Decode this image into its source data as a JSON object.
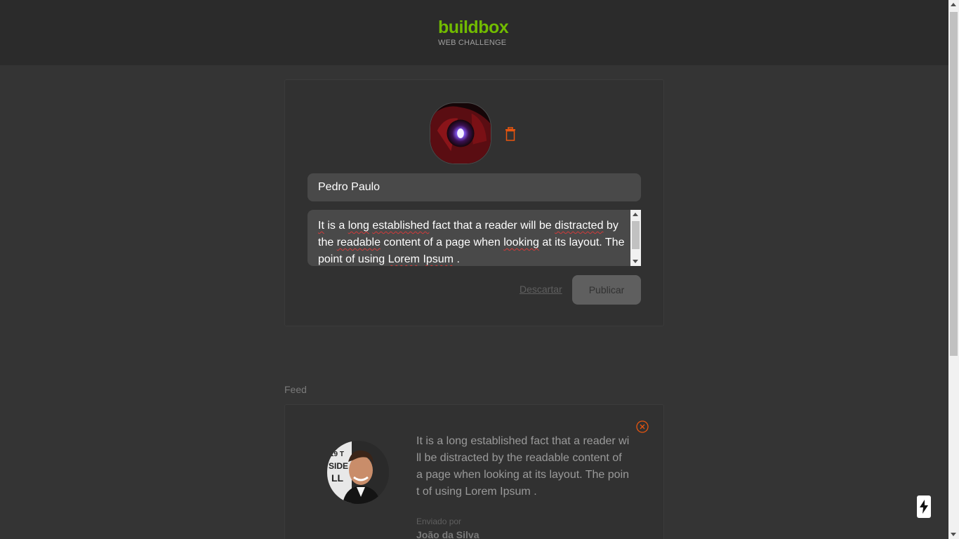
{
  "header": {
    "logo_title": "buildbox",
    "logo_subtitle": "WEB CHALLENGE"
  },
  "composer": {
    "avatar_icon": "user-photo",
    "trash_icon": "trash-icon",
    "name_value": "Pedro Paulo",
    "message_words": [
      "It",
      " is a ",
      "long",
      " ",
      "established",
      " fact that a reader will be ",
      "distracted",
      " by the ",
      "readable",
      " content of a page when ",
      "looking",
      " at its layout. The point of using ",
      "Lorem",
      " ",
      "Ipsum",
      " ."
    ],
    "discard_label": "Descartar",
    "publish_label": "Publicar"
  },
  "feed": {
    "label": "Feed",
    "posts": [
      {
        "text": "It is a long established fact that a reader will be distracted by the readable content of a page when looking at its layout. The point of using Lorem Ipsum .",
        "sent_by_label": "Enviado por",
        "author": "João da Silva"
      }
    ]
  },
  "colors": {
    "brand": "#71bb00",
    "accent": "#e8550f",
    "background": "#343434",
    "header": "#2b2b2b"
  }
}
